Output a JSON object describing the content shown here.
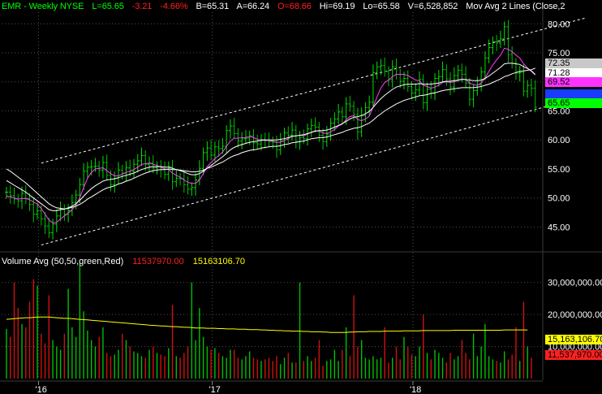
{
  "header": {
    "symbol": "EMR - Weekly  NYSE",
    "last": "L=65.65",
    "change": "-3.21",
    "change_pct": "-4.66%",
    "bid": "B=65.31",
    "ask": "A=66.24",
    "open": "O=68.66",
    "high": "Hi=69.19",
    "low": "Lo=65.58",
    "volume": "V=6,528,852",
    "study": "Mov Avg 2 Lines (Close,2"
  },
  "volume_header": {
    "label": "Volume Avg (50,50,green,Red)",
    "value1": "11537970.00",
    "value2": "15163106.70"
  },
  "price_badges": [
    {
      "text": "72.35",
      "bg": "#c8c8c8",
      "fg": "#000000"
    },
    {
      "text": "71.28",
      "bg": "#ffffff",
      "fg": "#000000"
    },
    {
      "text": "69.52",
      "bg": "#ff33ff",
      "fg": "#000000"
    },
    {
      "text": "67.18",
      "bg": "#1a3cff",
      "fg": "#1a3cff"
    },
    {
      "text": "65.65",
      "bg": "#00ff00",
      "fg": "#000000"
    }
  ],
  "volume_badges": [
    {
      "text": "15,163,106.70",
      "bg": "#ffff00",
      "fg": "#000000"
    },
    {
      "text": "11,537,970.00",
      "bg": "#ff2020",
      "fg": "#000000"
    }
  ],
  "colors": {
    "up_bar": "#00e000",
    "down_bar": "#00c000",
    "ma_short": "#ff40ff",
    "ma_mid": "#2040ff",
    "ma_long": "#ffffff",
    "channel": "#ffffff",
    "vol_up": "#00c000",
    "vol_down": "#d01010",
    "vol_avg": "#ffff00",
    "grid": "#505050",
    "change_red": "#ff2020",
    "header_green": "#00ff00",
    "header_white": "#ffffff"
  },
  "chart_data": [
    {
      "type": "candlestick",
      "title": "EMR - Weekly  NYSE",
      "x_tick_labels": [
        "'16",
        "'17",
        "'18"
      ],
      "y_tick_labels": [
        "45.00",
        "50.00",
        "55.00",
        "60.00",
        "65.00",
        "70.00",
        "75.00",
        "80.00"
      ],
      "ylim": [
        41,
        82
      ],
      "grid": true,
      "series": [
        {
          "name": "close",
          "values": [
            51.0,
            50.4,
            49.8,
            49.5,
            50.8,
            49.9,
            48.9,
            47.2,
            47.8,
            46.4,
            45.2,
            44.0,
            45.5,
            46.9,
            48.0,
            47.2,
            47.8,
            49.2,
            50.5,
            52.3,
            54.6,
            55.3,
            55.4,
            55.5,
            54.8,
            56.1,
            53.9,
            52.3,
            53.4,
            54.8,
            54.3,
            55.2,
            54.6,
            55.8,
            56.4,
            57.3,
            55.8,
            56.0,
            55.2,
            55.4,
            54.9,
            54.1,
            55.4,
            52.8,
            53.4,
            53.3,
            52.3,
            51.5,
            51.8,
            53.1,
            55.1,
            57.8,
            58.6,
            57.4,
            58.8,
            58.5,
            58.9,
            61.6,
            62.4,
            61.1,
            59.8,
            60.2,
            60.3,
            60.7,
            59.5,
            59.3,
            60.1,
            59.9,
            59.7,
            59.6,
            58.3,
            59.8,
            61.2,
            60.8,
            61.7,
            59.7,
            60.4,
            60.2,
            61.9,
            62.5,
            62.2,
            60.8,
            59.7,
            61.0,
            62.9,
            63.6,
            64.8,
            64.0,
            66.2,
            65.8,
            64.4,
            61.4,
            64.2,
            65.6,
            66.5,
            71.6,
            72.6,
            72.8,
            71.8,
            70.4,
            72.6,
            71.3,
            70.1,
            70.6,
            69.2,
            68.1,
            68.6,
            70.4,
            66.4,
            68.7,
            68.0,
            70.6,
            70.9,
            72.1,
            70.5,
            69.1,
            71.1,
            72.0,
            71.3,
            69.8,
            67.0,
            68.5,
            69.5,
            71.7,
            74.1,
            75.9,
            76.9,
            76.7,
            77.4,
            79.5,
            74.7,
            73.2,
            71.5,
            71.6,
            68.4,
            69.4,
            68.9,
            65.65
          ]
        },
        {
          "name": "Mov Avg 2 Lines",
          "values": [
            50.3,
            50.2,
            50.0,
            49.8,
            49.9,
            49.9,
            49.7,
            49.3,
            48.9,
            48.2,
            47.2,
            46.2,
            45.7,
            45.8,
            46.4,
            46.9,
            47.4,
            48.0,
            48.8,
            50.1,
            51.8,
            53.4,
            54.4,
            55.0,
            55.1,
            55.2,
            54.7,
            54.2,
            53.8,
            53.8,
            54.1,
            54.4,
            54.6,
            54.9,
            55.3,
            55.8,
            55.9,
            56.0,
            55.8,
            55.6,
            55.3,
            55.0,
            54.9,
            54.3,
            53.9,
            53.6,
            53.1,
            52.7,
            52.5,
            52.5,
            53.1,
            54.2,
            55.4,
            56.1,
            56.8,
            57.3,
            57.9,
            58.9,
            59.8,
            60.3,
            60.3,
            60.4,
            60.4,
            60.6,
            60.4,
            60.1,
            60.0,
            59.9,
            59.9,
            59.8,
            59.6,
            59.6,
            59.9,
            60.2,
            60.7,
            60.7,
            60.8,
            60.7,
            61.0,
            61.3,
            61.6,
            61.5,
            61.2,
            61.1,
            61.4,
            61.8,
            62.4,
            62.7,
            63.5,
            64.0,
            64.2,
            63.5,
            63.3,
            63.6,
            64.1,
            65.7,
            67.4,
            68.9,
            69.9,
            70.3,
            70.9,
            71.3,
            71.3,
            71.3,
            71.1,
            70.7,
            70.3,
            70.2,
            69.4,
            69.2,
            68.9,
            69.1,
            69.4,
            69.9,
            70.0,
            69.9,
            70.0,
            70.3,
            70.5,
            70.4,
            69.8,
            69.5,
            69.4,
            69.8,
            70.7,
            71.8,
            72.9,
            73.8,
            74.6,
            75.8,
            75.6,
            75.2,
            74.6,
            74.1,
            73.1,
            72.4,
            71.8,
            71.2
          ]
        },
        {
          "name": "Mov Avg 2 Lines",
          "values": [
            55.0,
            54.6,
            54.1,
            53.6,
            53.1,
            52.6,
            52.0,
            51.4,
            50.8,
            50.2,
            49.6,
            49.0,
            48.6,
            48.3,
            48.2,
            48.1,
            48.2,
            48.4,
            48.6,
            48.9,
            49.3,
            49.8,
            50.2,
            50.6,
            51.0,
            51.4,
            51.7,
            51.9,
            52.1,
            52.4,
            52.6,
            52.9,
            53.1,
            53.4,
            53.7,
            54.0,
            54.3,
            54.5,
            54.7,
            54.8,
            54.9,
            54.9,
            55.0,
            54.9,
            54.9,
            54.8,
            54.7,
            54.6,
            54.5,
            54.5,
            54.6,
            54.8,
            55.1,
            55.3,
            55.6,
            55.9,
            56.2,
            56.6,
            57.0,
            57.3,
            57.5,
            57.8,
            58.0,
            58.2,
            58.3,
            58.4,
            58.6,
            58.7,
            58.8,
            58.9,
            58.9,
            59.0,
            59.2,
            59.3,
            59.5,
            59.6,
            59.7,
            59.8,
            60.0,
            60.2,
            60.3,
            60.4,
            60.4,
            60.5,
            60.7,
            60.9,
            61.1,
            61.3,
            61.6,
            61.8,
            62.0,
            62.1,
            62.3,
            62.6,
            62.9,
            63.4,
            64.0,
            64.5,
            65.0,
            65.4,
            65.8,
            66.2,
            66.5,
            66.8,
            67.0,
            67.2,
            67.4,
            67.6,
            67.7,
            67.8,
            68.0,
            68.1,
            68.3,
            68.5,
            68.6,
            68.7,
            68.8,
            68.9,
            69.0,
            69.0,
            69.0,
            69.0,
            69.1,
            69.2,
            69.4,
            69.6,
            69.9,
            70.2,
            70.5,
            70.9,
            71.1,
            71.4,
            71.6,
            71.8,
            71.9,
            72.0,
            72.1,
            72.35
          ]
        },
        {
          "name": "Mov Avg 2 Lines",
          "values": [
            53.0,
            52.6,
            52.2,
            51.8,
            51.4,
            51.0,
            50.5,
            50.0,
            49.5,
            49.0,
            48.5,
            48.0,
            47.8,
            47.8,
            48.0,
            48.1,
            48.3,
            48.6,
            49.0,
            49.6,
            50.3,
            51.0,
            51.6,
            52.1,
            52.5,
            52.9,
            53.1,
            53.2,
            53.3,
            53.5,
            53.7,
            53.9,
            54.1,
            54.3,
            54.6,
            54.9,
            55.1,
            55.3,
            55.4,
            55.4,
            55.4,
            55.3,
            55.3,
            55.1,
            54.9,
            54.7,
            54.5,
            54.2,
            54.0,
            54.0,
            54.2,
            54.6,
            55.1,
            55.6,
            56.1,
            56.6,
            57.1,
            57.7,
            58.3,
            58.7,
            59.0,
            59.2,
            59.4,
            59.6,
            59.7,
            59.8,
            59.9,
            60.0,
            60.0,
            60.0,
            60.0,
            60.1,
            60.2,
            60.4,
            60.6,
            60.7,
            60.8,
            60.9,
            61.1,
            61.3,
            61.5,
            61.6,
            61.6,
            61.7,
            61.9,
            62.2,
            62.5,
            62.8,
            63.2,
            63.6,
            63.9,
            64.0,
            64.2,
            64.5,
            64.9,
            65.6,
            66.4,
            67.1,
            67.7,
            68.2,
            68.7,
            69.1,
            69.3,
            69.5,
            69.6,
            69.6,
            69.6,
            69.7,
            69.6,
            69.6,
            69.6,
            69.7,
            69.8,
            70.0,
            70.1,
            70.1,
            70.2,
            70.3,
            70.4,
            70.4,
            70.3,
            70.2,
            70.2,
            70.3,
            70.6,
            71.0,
            71.5,
            72.0,
            72.5,
            73.1,
            73.2,
            73.2,
            73.1,
            73.0,
            72.6,
            72.3,
            71.9,
            71.28
          ]
        }
      ],
      "channel_lines": [
        {
          "start": [
            9,
            56.0
          ],
          "end": [
            150,
            81.0
          ]
        },
        {
          "start": [
            9,
            41.9
          ],
          "end": [
            150,
            67.6
          ]
        }
      ],
      "last_values": {
        "ma_a": 72.35,
        "ma_b": 71.28,
        "ma_c": 69.52,
        "ma_d": 67.18,
        "last": 65.65
      }
    },
    {
      "type": "bar",
      "title": "Volume Avg (50,50,green,Red)",
      "y_tick_labels": [
        "30,000,000.00",
        "20,000,000.00",
        "10,000,000.00"
      ],
      "ylim": [
        0,
        35000000
      ],
      "grid": true,
      "series": [
        {
          "name": "volume",
          "values": [
            15.5,
            13.0,
            30.0,
            22.0,
            17.0,
            16.0,
            24.0,
            31.0,
            29.0,
            14.0,
            11.0,
            26.0,
            12.0,
            10.0,
            9.0,
            14.0,
            28.0,
            16.0,
            13.0,
            36.0,
            21.0,
            15.0,
            12.0,
            10.0,
            13.0,
            16.0,
            8.0,
            7.0,
            7.5,
            9.0,
            14.0,
            12.0,
            10.0,
            8.5,
            8.0,
            7.0,
            6.5,
            9.0,
            10.0,
            8.0,
            7.5,
            7.0,
            9.5,
            23.0,
            7.0,
            6.5,
            8.0,
            10.0,
            30.0,
            12.0,
            22.0,
            13.0,
            10.0,
            9.0,
            9.5,
            8.0,
            7.0,
            6.5,
            9.0,
            9.0,
            6.5,
            6.0,
            7.0,
            8.5,
            6.5,
            6.0,
            5.5,
            6.0,
            6.5,
            5.5,
            7.0,
            4.5,
            6.5,
            8.0,
            5.0,
            5.0,
            30.0,
            5.5,
            7.0,
            5.5,
            6.5,
            12.0,
            4.0,
            5.5,
            6.0,
            9.0,
            5.5,
            9.0,
            16.0,
            7.0,
            26.0,
            10.0,
            12.0,
            6.5,
            6.0,
            7.0,
            6.0,
            6.5,
            16.0,
            5.0,
            6.5,
            10.0,
            6.0,
            13.0,
            10.0,
            7.5,
            7.0,
            10.0,
            20.0,
            8.0,
            6.0,
            9.0,
            8.0,
            6.5,
            5.0,
            8.0,
            6.0,
            7.0,
            12.0,
            8.0,
            6.0,
            14.0,
            7.0,
            10.0,
            17.0,
            7.0,
            6.0,
            5.5,
            5.0,
            8.5,
            6.0,
            7.5,
            16.0,
            5.5,
            24.0,
            10.0,
            6.5
          ]
        },
        {
          "name": "Volume Avg (50,50,green,Red)",
          "values": [
            18.5,
            18.6,
            18.7,
            18.8,
            18.9,
            19.0,
            19.0,
            19.1,
            19.2,
            19.2,
            19.2,
            19.2,
            19.1,
            19.0,
            18.9,
            18.8,
            18.8,
            18.7,
            18.6,
            18.5,
            18.4,
            18.3,
            18.2,
            18.1,
            18.0,
            17.9,
            17.8,
            17.7,
            17.6,
            17.5,
            17.4,
            17.3,
            17.2,
            17.1,
            17.0,
            16.9,
            16.8,
            16.7,
            16.6,
            16.5,
            16.4,
            16.4,
            16.3,
            16.2,
            16.2,
            16.1,
            16.0,
            16.0,
            15.9,
            15.8,
            15.8,
            15.8,
            15.7,
            15.7,
            15.7,
            15.6,
            15.6,
            15.5,
            15.5,
            15.5,
            15.4,
            15.4,
            15.4,
            15.3,
            15.3,
            15.3,
            15.2,
            15.2,
            15.1,
            15.1,
            15.0,
            15.0,
            14.9,
            14.9,
            14.8,
            14.8,
            14.8,
            14.7,
            14.7,
            14.6,
            14.6,
            14.6,
            14.5,
            14.5,
            14.4,
            14.4,
            14.4,
            14.4,
            14.4,
            14.5,
            14.5,
            14.6,
            14.6,
            14.6,
            14.7,
            14.7,
            14.7,
            14.7,
            14.8,
            14.8,
            14.8,
            14.8,
            14.8,
            14.9,
            14.9,
            14.9,
            14.9,
            14.9,
            15.0,
            15.0,
            15.0,
            15.0,
            15.0,
            15.0,
            15.0,
            15.0,
            15.1,
            15.1,
            15.1,
            15.1,
            15.1,
            15.1,
            15.1,
            15.1,
            15.1,
            15.1,
            15.1,
            15.1,
            15.1,
            15.2,
            15.2,
            15.2,
            15.2,
            15.2,
            15.2,
            15.16
          ]
        }
      ]
    }
  ]
}
